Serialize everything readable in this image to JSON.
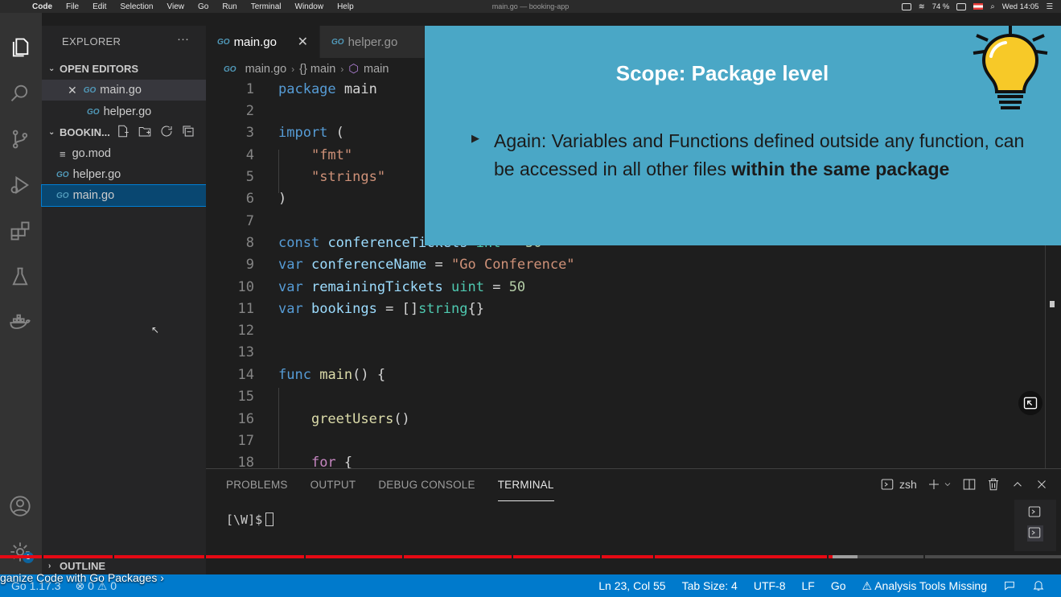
{
  "menubar": {
    "app": "Code",
    "items": [
      "File",
      "Edit",
      "Selection",
      "View",
      "Go",
      "Run",
      "Terminal",
      "Window",
      "Help"
    ],
    "window_title": "main.go — booking-app",
    "battery": "74 %",
    "clock": "Wed 14:05"
  },
  "sidebar": {
    "title": "EXPLORER",
    "more": "···",
    "open_editors_label": "OPEN EDITORS",
    "open_editors": [
      {
        "name": "main.go",
        "close": "✕"
      },
      {
        "name": "helper.go"
      }
    ],
    "project_label": "BOOKIN...",
    "files": [
      {
        "name": "go.mod",
        "icon": "mod-file-icon"
      },
      {
        "name": "helper.go",
        "icon": "go-file-icon"
      },
      {
        "name": "main.go",
        "icon": "go-file-icon"
      }
    ],
    "go_icon": "GO",
    "outline_label": "OUTLINE"
  },
  "tabs": [
    {
      "label": "main.go",
      "close": "✕"
    },
    {
      "label": "helper.go"
    }
  ],
  "breadcrumb": {
    "file": "main.go",
    "scope": "{} main",
    "symbol": "main"
  },
  "editor": {
    "line_numbers": [
      "1",
      "2",
      "3",
      "4",
      "5",
      "6",
      "7",
      "8",
      "9",
      "10",
      "11",
      "12",
      "13",
      "14",
      "15",
      "16",
      "17",
      "18"
    ]
  },
  "slide": {
    "title": "Scope: Package level",
    "bullet": "▶",
    "text_plain": "Again: Variables and Functions defined outside any function, can be accessed in all other files ",
    "text_bold": "within the same package"
  },
  "panel": {
    "tabs": [
      "PROBLEMS",
      "OUTPUT",
      "DEBUG CONSOLE",
      "TERMINAL"
    ],
    "shell": "zsh",
    "prompt": "[\\W]$"
  },
  "progress": {
    "played_fraction": 0.785,
    "buffered_fraction": 0.808
  },
  "video_chapter": "ganize Code with Go Packages",
  "status": {
    "go_version": "Go 1.17.3",
    "problems": "⊗ 0 ⚠ 0",
    "position": "Ln 23, Col 55",
    "tab_size": "Tab Size: 4",
    "encoding": "UTF-8",
    "eol": "LF",
    "language": "Go",
    "analysis": "Analysis Tools Missing"
  },
  "colors": {
    "activity_bar": "#333333",
    "sidebar": "#252526",
    "editor": "#1e1e1e",
    "status_bar": "#007acc",
    "slide": "#4aa7c6",
    "progress": "#e50914"
  }
}
